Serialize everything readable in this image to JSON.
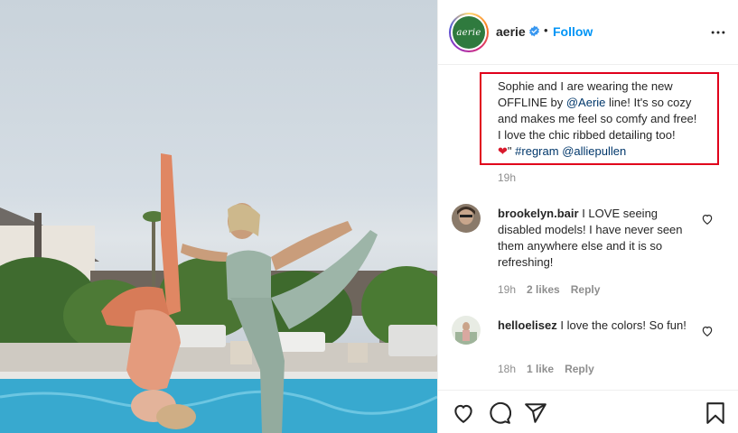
{
  "post": {
    "username": "aerie",
    "avatar_text": "aerie",
    "follow_label": "Follow",
    "separator": "•",
    "caption": {
      "line1": "Sophie and I are wearing the new",
      "line2_pre": "OFFLINE by ",
      "line2_mention": "@Aerie",
      "line2_post": " line! It's so cozy",
      "line3": "and makes me feel so comfy and free!",
      "line4": "I love the chic ribbed detailing too!",
      "line5_emoji": "❤",
      "line5_quote": "\"",
      "hashtag": "#regram",
      "mention2": "@alliepullen"
    },
    "caption_time": "19h"
  },
  "comments": [
    {
      "username": "brookelyn.bair",
      "text": "I LOVE seeing disabled models! I have never seen them anywhere else and it is so refreshing!",
      "time": "19h",
      "likes": "2 likes",
      "reply": "Reply"
    },
    {
      "username": "helloelisez",
      "text": "I love the colors! So fun!",
      "time": "18h",
      "likes": "1 like",
      "reply": "Reply"
    }
  ],
  "colors": {
    "follow": "#0095f6",
    "highlight_border": "#e0001b",
    "link": "#00376b",
    "meta": "#8e8e8e"
  },
  "icons": {
    "verified": "verified-badge-icon",
    "more": "more-options-icon",
    "like": "heart-icon",
    "comment": "comment-icon",
    "share": "share-icon",
    "save": "bookmark-icon"
  }
}
